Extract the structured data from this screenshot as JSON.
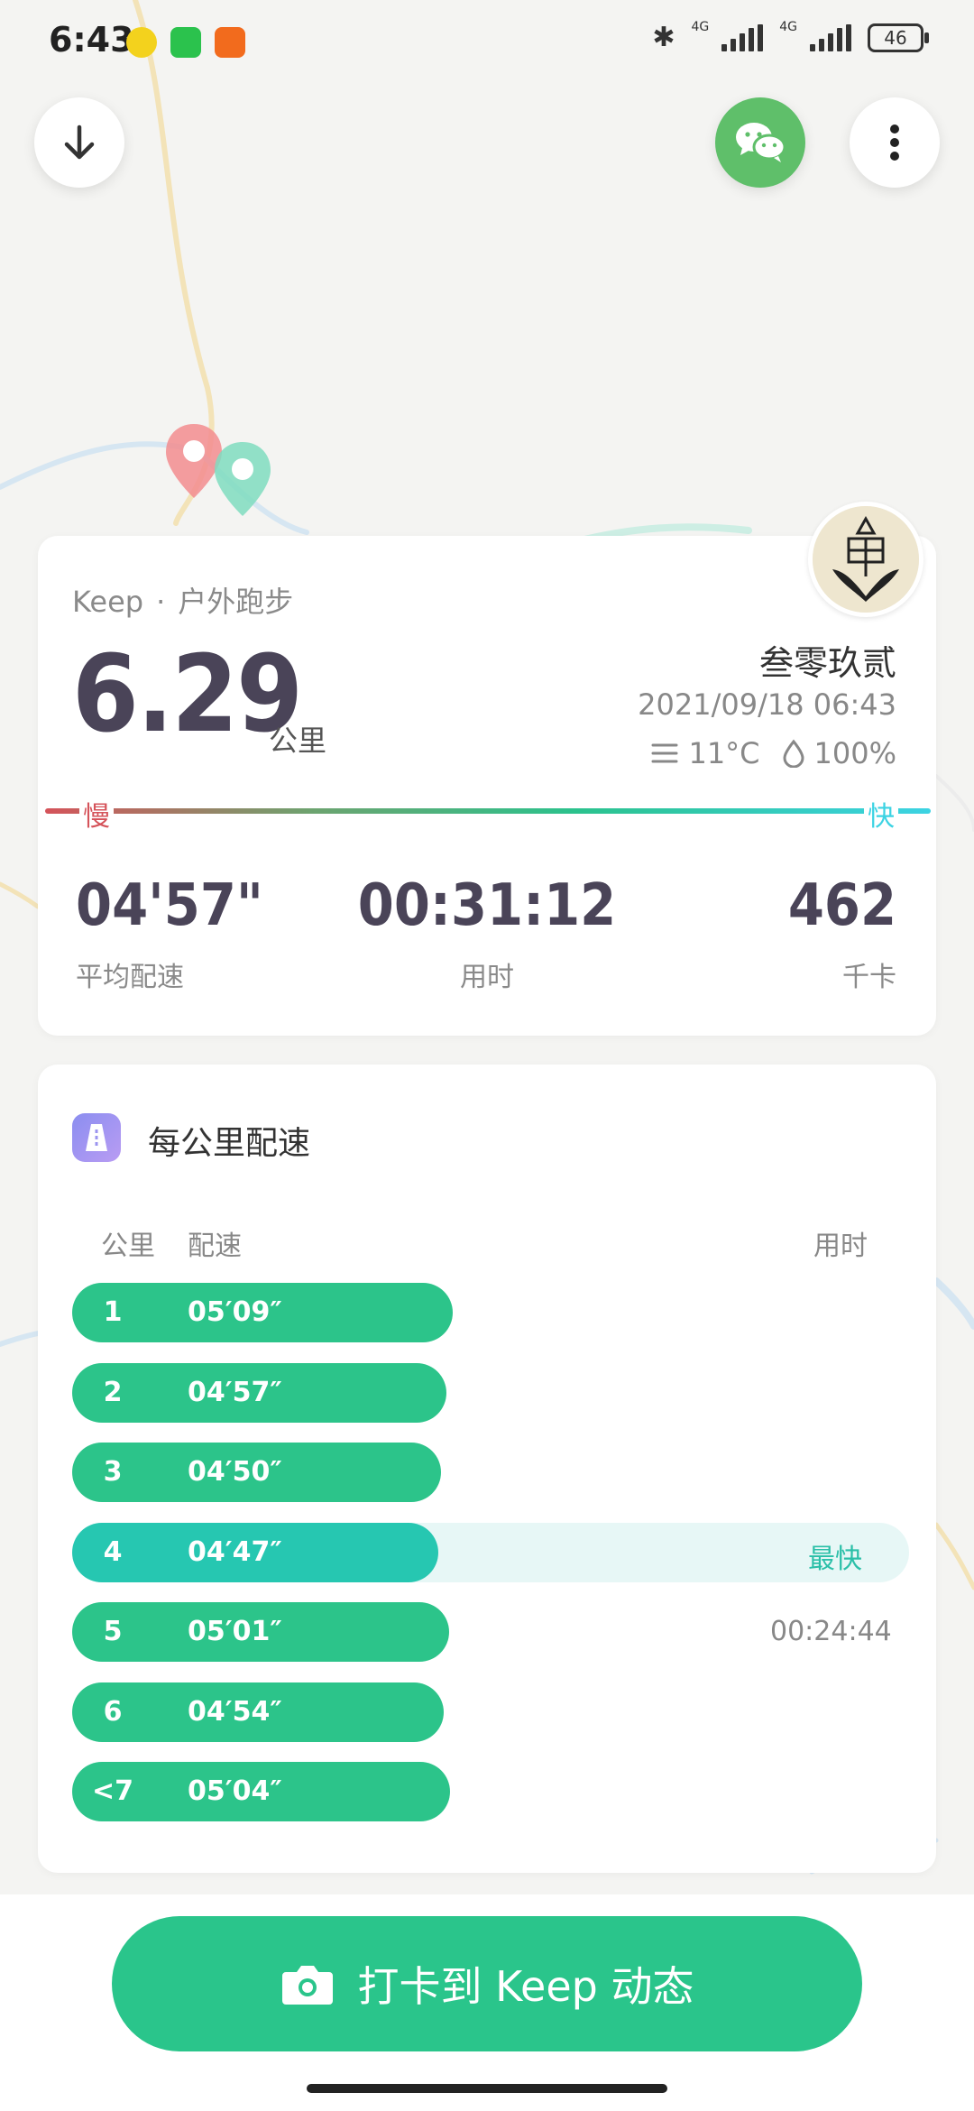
{
  "status_bar": {
    "time": "6:43",
    "net1": "4G",
    "net2": "4G",
    "battery": "46"
  },
  "top_actions": {
    "download": "download-icon",
    "share": "wechat-icon",
    "more": "more-vertical-icon"
  },
  "summary": {
    "brand": "Keep",
    "separator": "·",
    "activity": "户外跑步",
    "distance": "6.29",
    "distance_unit": "公里",
    "username": "叁零玖贰",
    "datetime": "2021/09/18 06:43",
    "temperature": "11°C",
    "humidity": "100%",
    "slow_label": "慢",
    "fast_label": "快",
    "stats": [
      {
        "value": "04'57\"",
        "label": "平均配速"
      },
      {
        "value": "00:31:12",
        "label": "用时"
      },
      {
        "value": "462",
        "label": "千卡"
      }
    ]
  },
  "pace_section": {
    "title": "每公里配速",
    "col_km": "公里",
    "col_pace": "配速",
    "col_time": "用时",
    "rows": [
      {
        "km": "1",
        "pace": "05′09″",
        "fraction": 0.455
      },
      {
        "km": "2",
        "pace": "04′57″",
        "fraction": 0.447
      },
      {
        "km": "3",
        "pace": "04′50″",
        "fraction": 0.441
      },
      {
        "km": "4",
        "pace": "04′47″",
        "fraction": 0.438,
        "tag": "最快"
      },
      {
        "km": "5",
        "pace": "05′01″",
        "fraction": 0.45,
        "elapsed": "00:24:44"
      },
      {
        "km": "6",
        "pace": "04′54″",
        "fraction": 0.444
      },
      {
        "km": "<7",
        "pace": "05′04″",
        "fraction": 0.451
      }
    ]
  },
  "cta": {
    "label": "打卡到 Keep 动态",
    "icon": "camera-icon"
  },
  "colors": {
    "accent": "#2ac58b",
    "slow": "#d5535a",
    "fast": "#3cd3e3",
    "best": "#26c7b1"
  }
}
